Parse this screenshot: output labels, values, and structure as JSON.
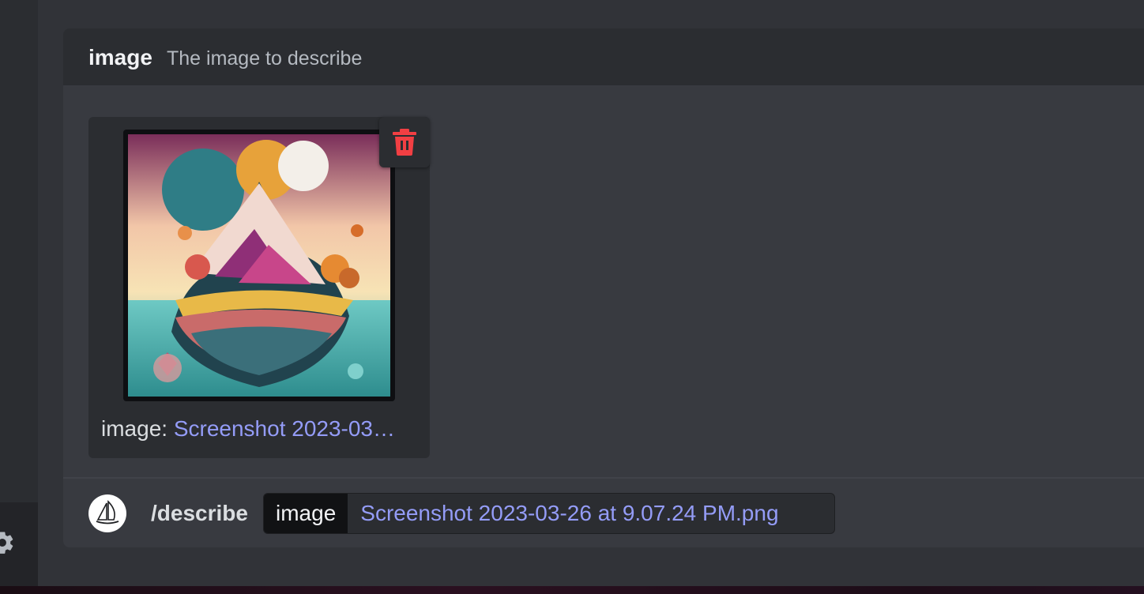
{
  "option": {
    "name": "image",
    "description": "The image to describe"
  },
  "attachment": {
    "caption_label": "image:",
    "caption_file": "Screenshot 2023-03…",
    "delete_icon": "trash-icon"
  },
  "command": {
    "name": "/describe",
    "param_key": "image",
    "param_value": "Screenshot 2023-03-26 at 9.07.24 PM.png"
  },
  "icons": {
    "settings": "gear-icon",
    "bot_avatar": "sailboat-icon"
  },
  "colors": {
    "background": "#313338",
    "panel": "#383a40",
    "header": "#2b2d31",
    "link": "#949cf7",
    "danger": "#f23f43"
  }
}
